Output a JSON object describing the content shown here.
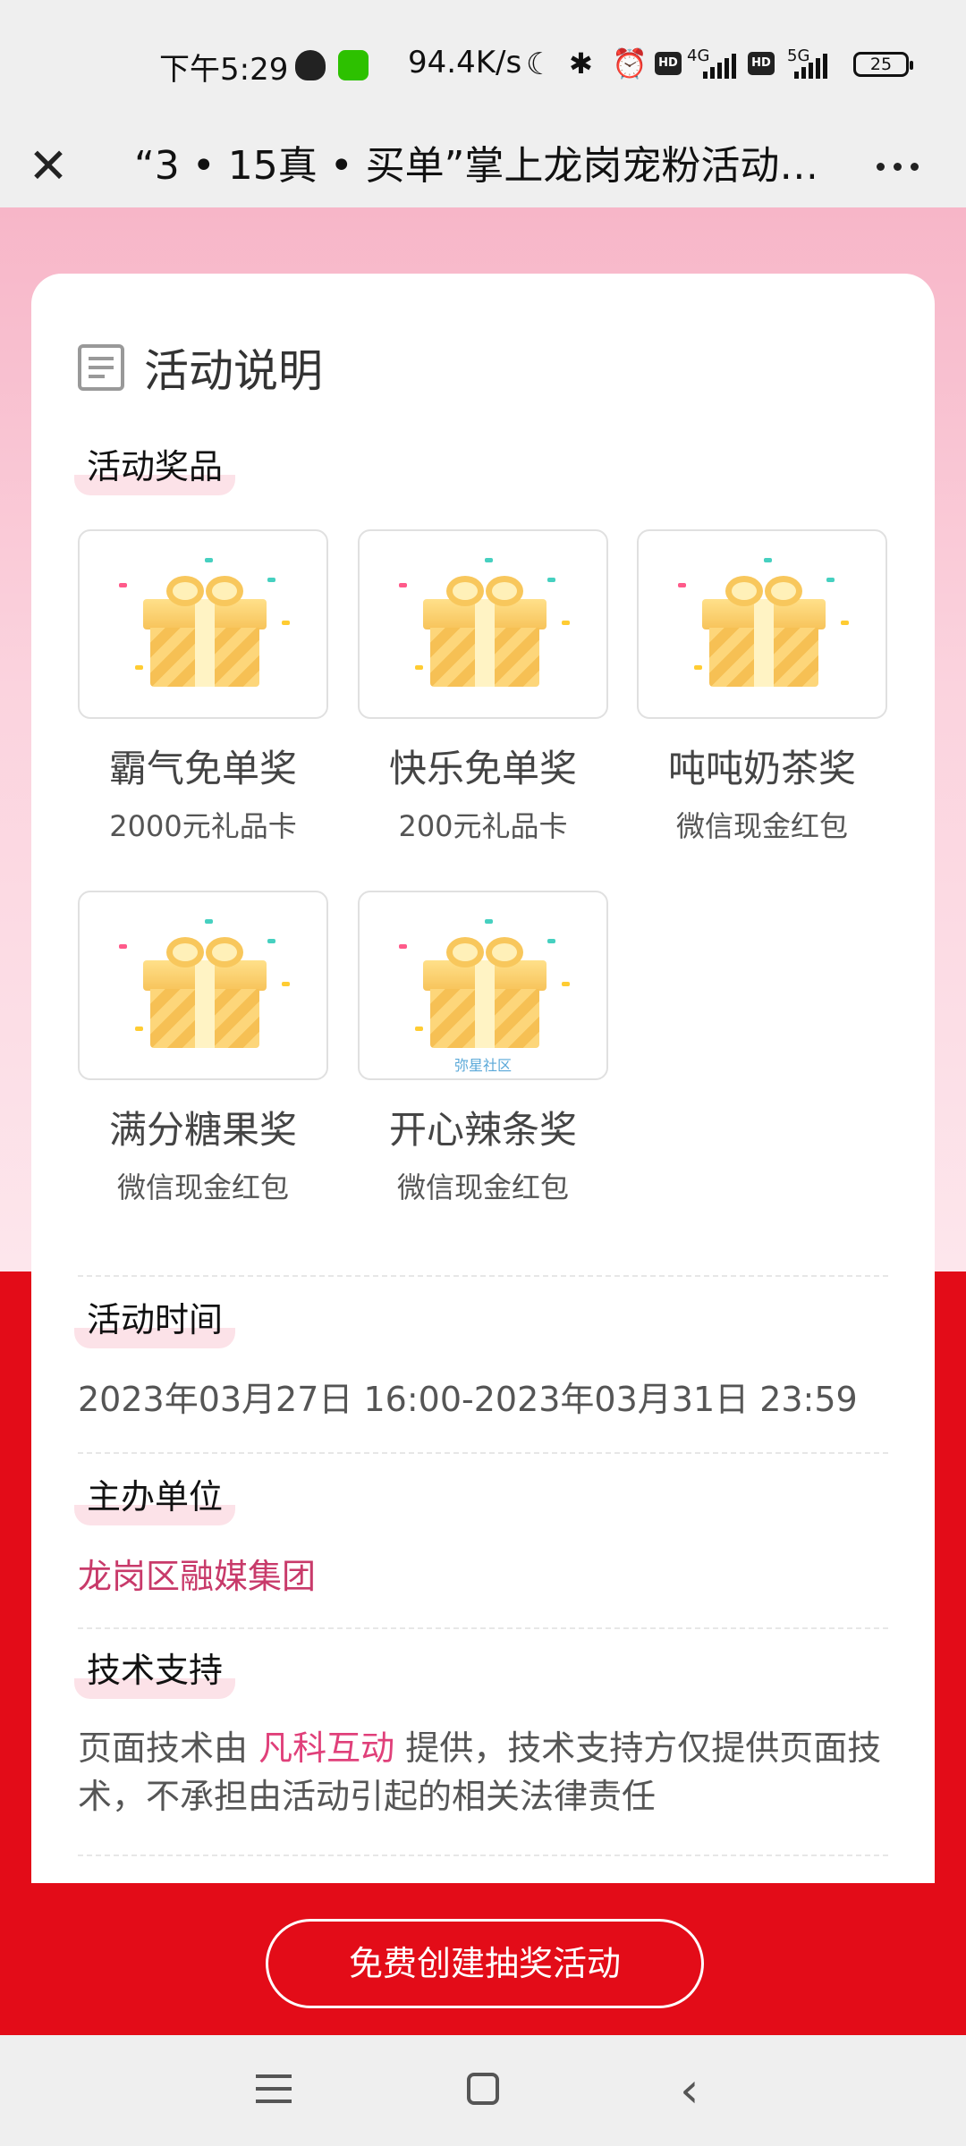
{
  "status_bar": {
    "time": "下午5:29",
    "net_speed": "94.4K/s",
    "hd1": "HD",
    "net1": "4G",
    "hd2": "HD",
    "net2": "5G",
    "battery": "25"
  },
  "title_bar": {
    "title": "“3 • 15真 • 买单”掌上龙岗宠粉活动…"
  },
  "card": {
    "title": "活动说明",
    "prizes_label": "活动奖品",
    "prizes": [
      {
        "name": "霸气免单奖",
        "desc": "2000元礼品卡"
      },
      {
        "name": "快乐免单奖",
        "desc": "200元礼品卡"
      },
      {
        "name": "吨吨奶茶奖",
        "desc": "微信现金红包"
      },
      {
        "name": "满分糖果奖",
        "desc": "微信现金红包"
      },
      {
        "name": "开心辣条奖",
        "desc": "微信现金红包",
        "watermark": "弥星社区"
      }
    ],
    "time_label": "活动时间",
    "time_value": "2023年03月27日 16:00-2023年03月31日 23:59",
    "organizer_label": "主办单位",
    "organizer_value": "龙岗区融媒集团",
    "tech_label": "技术支持",
    "tech_prefix": "页面技术由 ",
    "tech_link": "凡科互动",
    "tech_suffix": " 提供，技术支持方仅提供页面技术，不承担由活动引起的相关法律责任"
  },
  "create_button": "免费创建抽奖活动",
  "colors": {
    "accent_red": "#e30c18",
    "organizer_text": "#c83a6a",
    "link_pink": "#e0407a"
  },
  "icons": [
    "qq-icon",
    "wechat-icon",
    "moon-icon",
    "bluetooth-icon",
    "alarm-icon",
    "signal-icon",
    "battery-icon",
    "close-icon",
    "more-icon",
    "document-icon",
    "gift-icon",
    "menu-icon",
    "home-icon",
    "back-icon"
  ]
}
